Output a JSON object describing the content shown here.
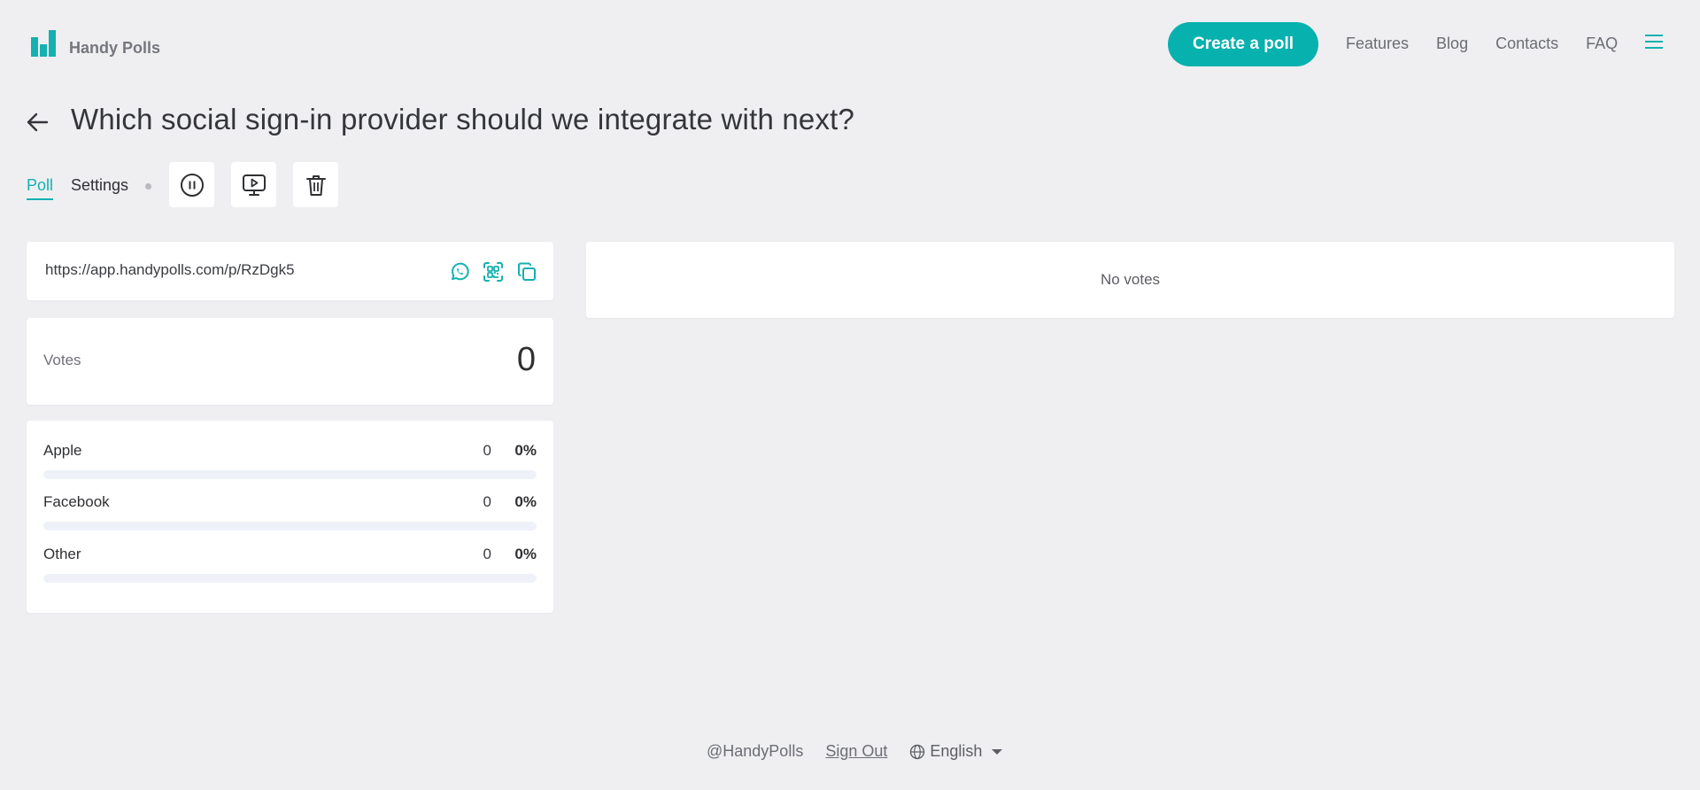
{
  "header": {
    "brand": "Handy Polls",
    "create_button": "Create a poll",
    "nav": [
      "Features",
      "Blog",
      "Contacts",
      "FAQ"
    ]
  },
  "poll": {
    "title": "Which social sign-in provider should we integrate with next?",
    "tabs": {
      "poll": "Poll",
      "settings": "Settings"
    },
    "tools": [
      "pause-icon",
      "present-icon",
      "trash-icon"
    ]
  },
  "share": {
    "url": "https://app.handypolls.com/p/RzDgk5",
    "icons": [
      "whatsapp-icon",
      "qr-code-icon",
      "copy-icon"
    ]
  },
  "votes": {
    "label": "Votes",
    "count": "0"
  },
  "options": [
    {
      "label": "Apple",
      "count": "0",
      "percent": "0%",
      "fill": 0
    },
    {
      "label": "Facebook",
      "count": "0",
      "percent": "0%",
      "fill": 0
    },
    {
      "label": "Other",
      "count": "0",
      "percent": "0%",
      "fill": 0
    }
  ],
  "chart": {
    "empty_text": "No votes"
  },
  "footer": {
    "handle": "@HandyPolls",
    "sign_out": "Sign Out",
    "language": "English"
  },
  "colors": {
    "accent": "#14b1b0",
    "background": "#efeff2"
  }
}
